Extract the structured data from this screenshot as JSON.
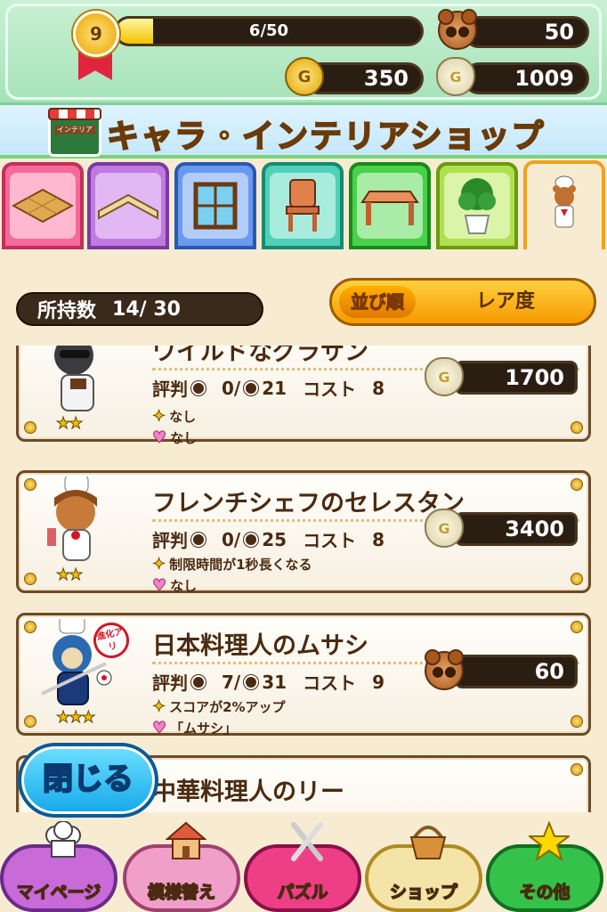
{
  "status": {
    "level": "9",
    "xp_text": "6/50",
    "xp_progress": 0.12,
    "bear_count": "50",
    "coins": "350",
    "money": "1009",
    "coin_icon_glyph": "G",
    "bag_icon_glyph": "G"
  },
  "title": {
    "sign": "インテリア",
    "text": "キャラ・インテリアショップ"
  },
  "tabs": [
    {
      "name": "floor",
      "icon": "floor-icon"
    },
    {
      "name": "wall",
      "icon": "wall-icon"
    },
    {
      "name": "window",
      "icon": "window-icon"
    },
    {
      "name": "chair",
      "icon": "chair-icon"
    },
    {
      "name": "table",
      "icon": "table-icon"
    },
    {
      "name": "plant",
      "icon": "plant-icon"
    },
    {
      "name": "chara",
      "icon": "bear-chef-icon",
      "active": true
    }
  ],
  "owned": {
    "label": "所持数",
    "value": "14/ 30"
  },
  "sort": {
    "button": "並び順",
    "value": "レア度"
  },
  "items": [
    {
      "name": "ワイルドなグラサン",
      "rep_label": "評判",
      "rep": "0/",
      "rep_max": "21",
      "cost_label": "コスト",
      "cost": "8",
      "effect": "なし",
      "love": "なし",
      "price": "1700",
      "currency": "money",
      "stars": "★★"
    },
    {
      "name": "フレンチシェフのセレスタン",
      "rep_label": "評判",
      "rep": "0/",
      "rep_max": "25",
      "cost_label": "コスト",
      "cost": "8",
      "effect": "制限時間が1秒長くなる",
      "love": "なし",
      "price": "3400",
      "currency": "money",
      "stars": "★★"
    },
    {
      "name": "日本料理人のムサシ",
      "rep_label": "評判",
      "rep": "7/",
      "rep_max": "31",
      "cost_label": "コスト",
      "cost": "9",
      "effect": "スコアが2%アップ",
      "love": "「ムサシ」",
      "price": "60",
      "currency": "bear",
      "stars": "★★★",
      "badge": "進化アリ"
    },
    {
      "name": "中華料理人のリー"
    }
  ],
  "close": "閉じる",
  "nav": [
    {
      "label": "マイページ",
      "icon": "chef-hat-icon",
      "color": "#c86ad8"
    },
    {
      "label": "模様替え",
      "icon": "house-icon",
      "color": "#f0a0c8"
    },
    {
      "label": "パズル",
      "icon": "fork-knife-icon",
      "color": "#ee3f86"
    },
    {
      "label": "ショップ",
      "icon": "basket-icon",
      "color": "#f4e4a8"
    },
    {
      "label": "その他",
      "icon": "star-icon",
      "color": "#35c24a"
    }
  ]
}
